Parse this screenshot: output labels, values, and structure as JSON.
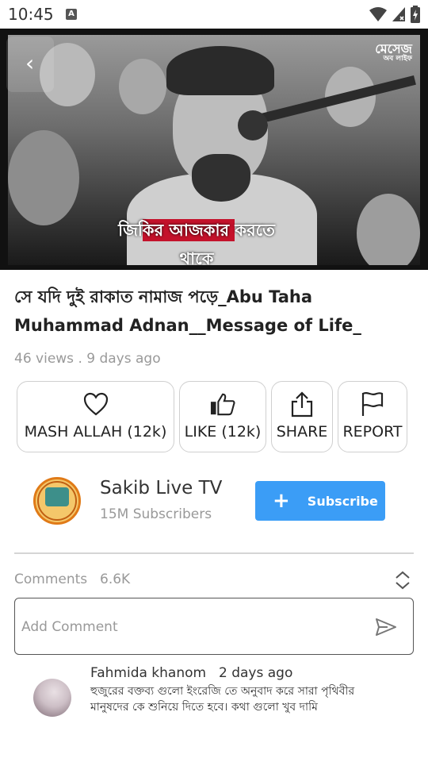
{
  "status_bar": {
    "time": "10:45",
    "icons": [
      "notification-a-icon",
      "wifi-icon",
      "cell-signal-icon",
      "battery-icon"
    ]
  },
  "video": {
    "caption": "জিকির আজকার করতে থাকে",
    "logo_line1": "মেসেজ",
    "logo_line2": "অব লাইফ"
  },
  "video_info": {
    "title": "সে যদি দুই রাকাত নামাজ পড়ে_Abu Taha Muhammad Adnan__Message of Life_",
    "meta": "46 views . 9 days ago"
  },
  "actions": [
    {
      "label": "MASH ALLAH (12k)",
      "icon": "heart-icon"
    },
    {
      "label": "LIKE (12k)",
      "icon": "thumbs-up-icon"
    },
    {
      "label": "SHARE",
      "icon": "share-icon"
    },
    {
      "label": "REPORT",
      "icon": "flag-icon"
    }
  ],
  "channel": {
    "name": "Sakib Live TV",
    "subscribers": "15M Subscribers",
    "subscribe_label": "Subscribe"
  },
  "comments": {
    "label": "Comments",
    "count": "6.6K",
    "input_placeholder": "Add Comment",
    "items": [
      {
        "author": "Fahmida khanom",
        "time": "2 days ago",
        "text": "হুজুরের বক্তব্য গুলো ইংরেজি তে অনুবাদ করে সারা পৃথিবীর মানুষদের কে শুনিয়ে দিতে হবে। কথা গুলো খুব দামি"
      }
    ]
  },
  "colors": {
    "accent": "#3b9df6",
    "caption_highlight": "#c4122b",
    "muted_text": "#999999",
    "border": "#cfcfcf"
  }
}
